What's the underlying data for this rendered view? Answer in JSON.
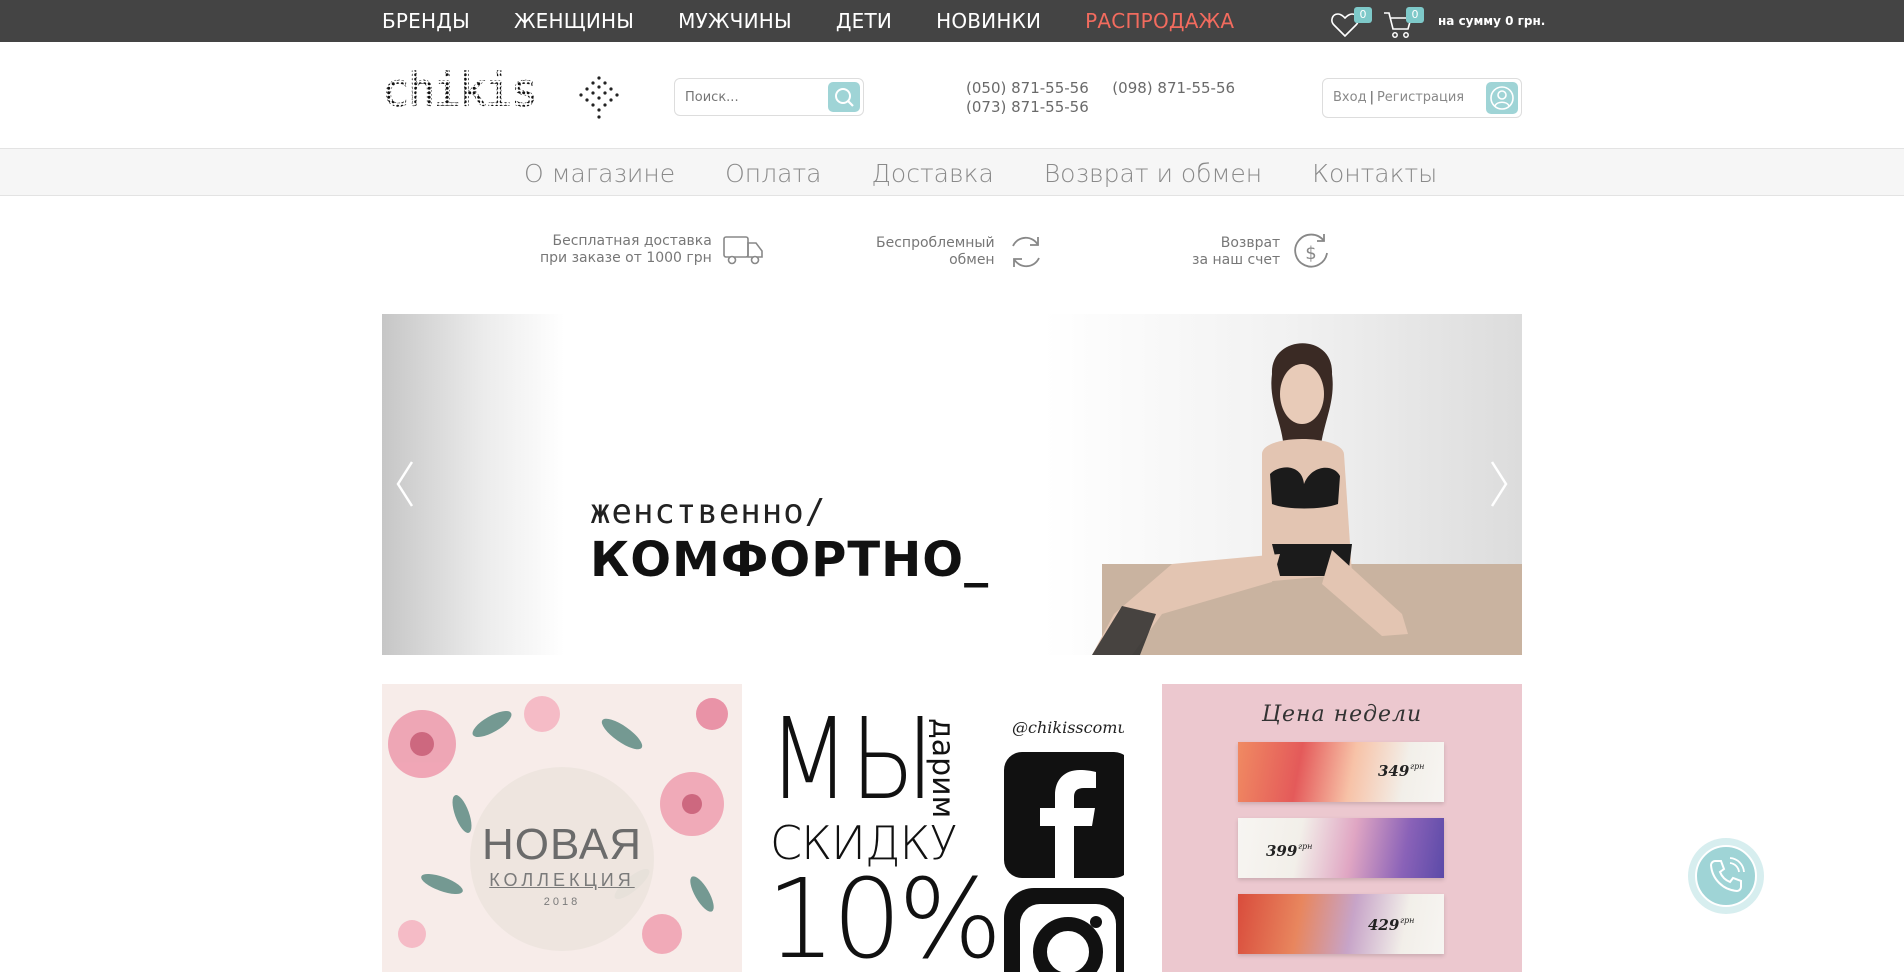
{
  "topnav": {
    "items": [
      "БРЕНДЫ",
      "ЖЕНЩИНЫ",
      "МУЖЧИНЫ",
      "ДЕТИ",
      "НОВИНКИ"
    ],
    "sale": "РАСПРОДАЖА"
  },
  "wishlist": {
    "count": "0",
    "icon": "heart-icon"
  },
  "cart": {
    "count": "0",
    "icon": "cart-icon",
    "sum_label": "на сумму 0 грн."
  },
  "logo": {
    "text": "chikiss"
  },
  "search": {
    "placeholder": "Поиск...",
    "icon": "search-icon"
  },
  "phones": [
    "(050) 871-55-56",
    "(098) 871-55-56",
    "(073) 871-55-56"
  ],
  "account": {
    "login": "Вход",
    "separator": "|",
    "register": "Регистрация",
    "icon": "user-icon"
  },
  "menu": [
    "О магазине",
    "Оплата",
    "Доставка",
    "Возврат и обмен",
    "Контакты"
  ],
  "features": [
    {
      "line1": "Бесплатная доставка",
      "line2": "при заказе от 1000 грн",
      "icon": "truck-icon"
    },
    {
      "line1": "Беспроблемный",
      "line2": "обмен",
      "icon": "refresh-icon"
    },
    {
      "line1": "Возврат",
      "line2": "за наш счет",
      "icon": "dollar-return-icon"
    }
  ],
  "slider": {
    "line1": "женственно/",
    "line2": "КОМФОРТНО_",
    "prev_icon": "chevron-left-icon",
    "next_icon": "chevron-right-icon"
  },
  "tiles": {
    "collection": {
      "title": "НОВАЯ",
      "subtitle": "КОЛЛЕКЦИЯ",
      "year": "2018"
    },
    "discount": {
      "line1": "МЫ",
      "side": "дарим",
      "line2": "СКИДКУ",
      "line3": "10%",
      "handle": "@chikisscomua",
      "icons": [
        "facebook-icon",
        "instagram-icon"
      ]
    },
    "price_week": {
      "title": "Цена недели",
      "prices": [
        {
          "value": "349",
          "unit": "грн"
        },
        {
          "value": "399",
          "unit": "грн"
        },
        {
          "value": "429",
          "unit": "грн"
        }
      ]
    }
  },
  "colors": {
    "topbar": "#444444",
    "accent": "#9fd4d6",
    "sale": "#f26b5e"
  },
  "call_button": {
    "icon": "phone-icon"
  }
}
